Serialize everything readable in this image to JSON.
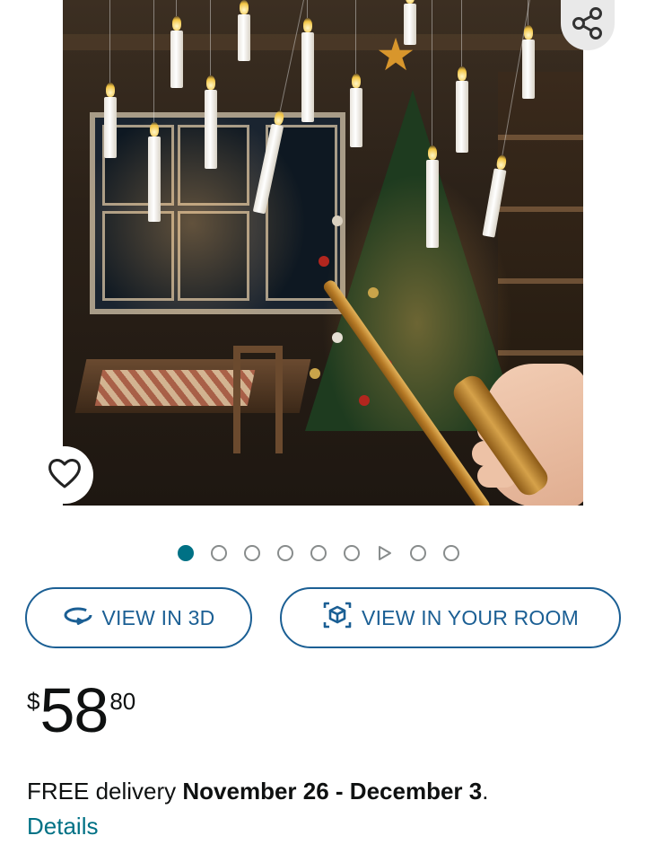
{
  "product_image": {
    "alt_subject": "floating-candles-with-wand",
    "share_icon": "share-icon",
    "wishlist_icon": "heart-icon"
  },
  "carousel": {
    "total_items": 9,
    "active_index": 0,
    "video_index": 6
  },
  "actions": {
    "view_3d_label": "VIEW IN 3D",
    "view_3d_icon": "rotate-3d-icon",
    "view_room_label": "VIEW IN YOUR ROOM",
    "view_room_icon": "ar-cube-icon"
  },
  "price": {
    "symbol": "$",
    "whole": "58",
    "fraction": "80"
  },
  "delivery": {
    "prefix": "FREE delivery ",
    "dates": "November 26 - December 3",
    "suffix": ".",
    "details_link": "Details"
  },
  "colors": {
    "link": "#007185",
    "button_border": "#1b5f94",
    "active_dot": "#007185",
    "text": "#0f1111"
  }
}
